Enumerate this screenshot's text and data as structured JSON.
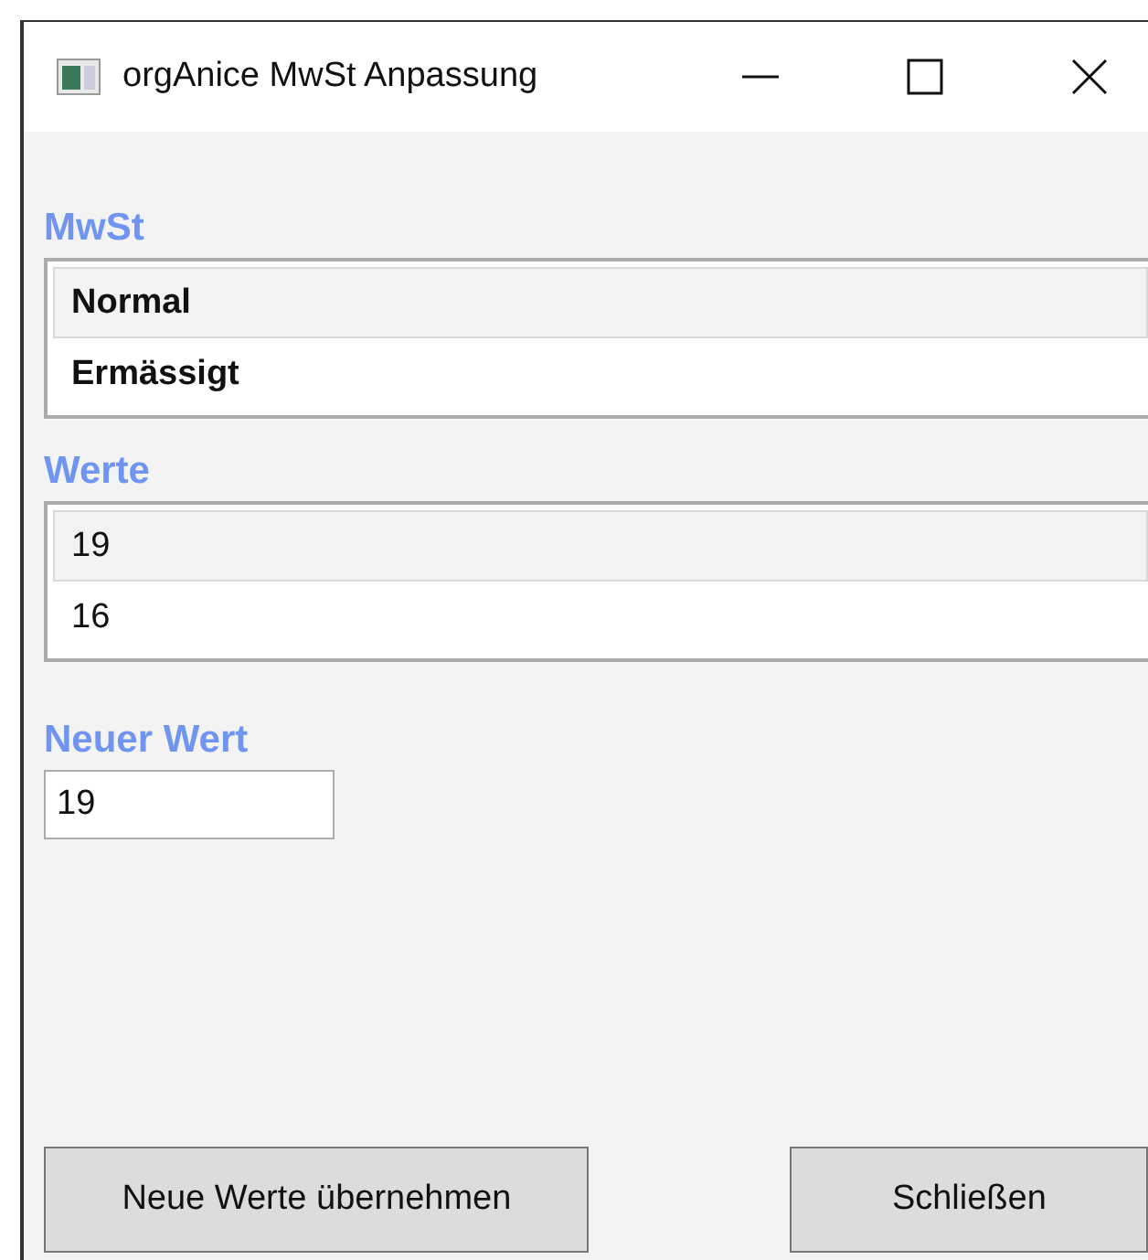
{
  "window": {
    "title": "orgAnice MwSt Anpassung"
  },
  "sections": [
    {
      "label": "MwSt",
      "bold_items": true,
      "items": [
        {
          "text": "Normal",
          "selected": true
        },
        {
          "text": "Ermässigt",
          "selected": false
        }
      ]
    },
    {
      "label": "Werte",
      "bold_items": false,
      "items": [
        {
          "text": "19",
          "selected": true
        },
        {
          "text": "16",
          "selected": false
        }
      ]
    }
  ],
  "new_value": {
    "label": "Neuer Wert",
    "value": "19"
  },
  "buttons": [
    "Neue Werte übernehmen",
    "Schließen"
  ]
}
